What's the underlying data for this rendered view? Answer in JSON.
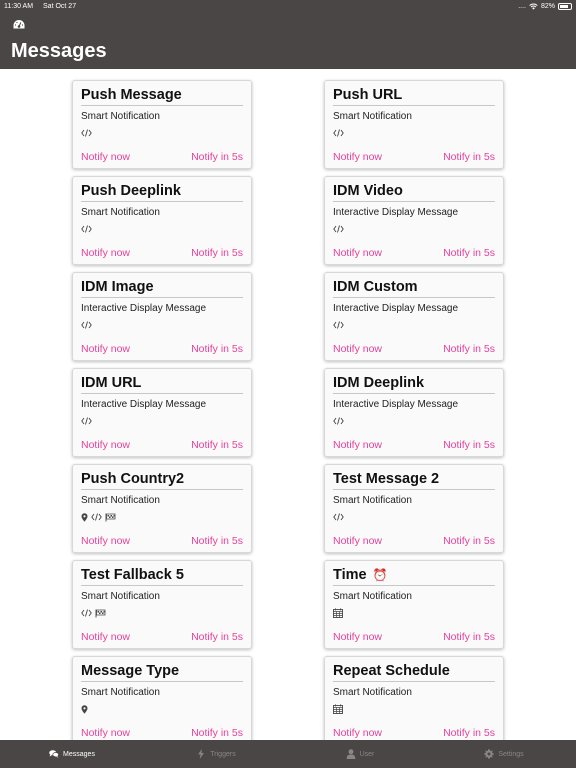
{
  "status_bar": {
    "time": "11:30 AM",
    "date": "Sat Oct 27",
    "signal": "....",
    "battery_text": "82%",
    "battery_level": 0.82
  },
  "header": {
    "icon": "dashboard-icon",
    "title": "Messages"
  },
  "colors": {
    "header_bg": "#4a4646",
    "accent": "#e6419a",
    "card_bg": "#fafafa"
  },
  "cards": [
    {
      "title": "Push Message",
      "emoji": "",
      "subtitle": "Smart Notification",
      "icons": [
        "code"
      ],
      "notify_now": "Notify now",
      "notify_later": "Notify in 5s"
    },
    {
      "title": "Push URL",
      "emoji": "",
      "subtitle": "Smart Notification",
      "icons": [
        "code"
      ],
      "notify_now": "Notify now",
      "notify_later": "Notify in 5s"
    },
    {
      "title": "Push Deeplink",
      "emoji": "",
      "subtitle": "Smart Notification",
      "icons": [
        "code"
      ],
      "notify_now": "Notify now",
      "notify_later": "Notify in 5s"
    },
    {
      "title": "IDM Video",
      "emoji": "",
      "subtitle": "Interactive Display Message",
      "icons": [
        "code"
      ],
      "notify_now": "Notify now",
      "notify_later": "Notify in 5s"
    },
    {
      "title": "IDM Image",
      "emoji": "",
      "subtitle": "Interactive Display Message",
      "icons": [
        "code"
      ],
      "notify_now": "Notify now",
      "notify_later": "Notify in 5s"
    },
    {
      "title": "IDM Custom",
      "emoji": "",
      "subtitle": "Interactive Display Message",
      "icons": [
        "code"
      ],
      "notify_now": "Notify now",
      "notify_later": "Notify in 5s"
    },
    {
      "title": "IDM URL",
      "emoji": "",
      "subtitle": "Interactive Display Message",
      "icons": [
        "code"
      ],
      "notify_now": "Notify now",
      "notify_later": "Notify in 5s"
    },
    {
      "title": "IDM Deeplink",
      "emoji": "",
      "subtitle": "Interactive Display Message",
      "icons": [
        "code"
      ],
      "notify_now": "Notify now",
      "notify_later": "Notify in 5s"
    },
    {
      "title": "Push Country2",
      "emoji": "",
      "subtitle": "Smart Notification",
      "icons": [
        "map-marker",
        "code",
        "flag"
      ],
      "notify_now": "Notify now",
      "notify_later": "Notify in 5s"
    },
    {
      "title": "Test Message 2",
      "emoji": "",
      "subtitle": "Smart Notification",
      "icons": [
        "code"
      ],
      "notify_now": "Notify now",
      "notify_later": "Notify in 5s"
    },
    {
      "title": "Test Fallback 5",
      "emoji": "",
      "subtitle": "Smart Notification",
      "icons": [
        "code",
        "flag"
      ],
      "notify_now": "Notify now",
      "notify_later": "Notify in 5s"
    },
    {
      "title": "Time",
      "emoji": "⏰",
      "subtitle": "Smart Notification",
      "icons": [
        "calendar"
      ],
      "notify_now": "Notify now",
      "notify_later": "Notify in 5s"
    },
    {
      "title": "Message Type",
      "emoji": "",
      "subtitle": "Smart Notification",
      "icons": [
        "map-marker"
      ],
      "notify_now": "Notify now",
      "notify_later": "Notify in 5s"
    },
    {
      "title": "Repeat Schedule",
      "emoji": "",
      "subtitle": "Smart Notification",
      "icons": [
        "calendar"
      ],
      "notify_now": "Notify now",
      "notify_later": "Notify in 5s"
    }
  ],
  "tabbar": [
    {
      "label": "Messages",
      "icon": "comments",
      "active": true
    },
    {
      "label": "Triggers",
      "icon": "bolt",
      "active": false
    },
    {
      "label": "User",
      "icon": "user",
      "active": false
    },
    {
      "label": "Settings",
      "icon": "gear",
      "active": false
    }
  ]
}
